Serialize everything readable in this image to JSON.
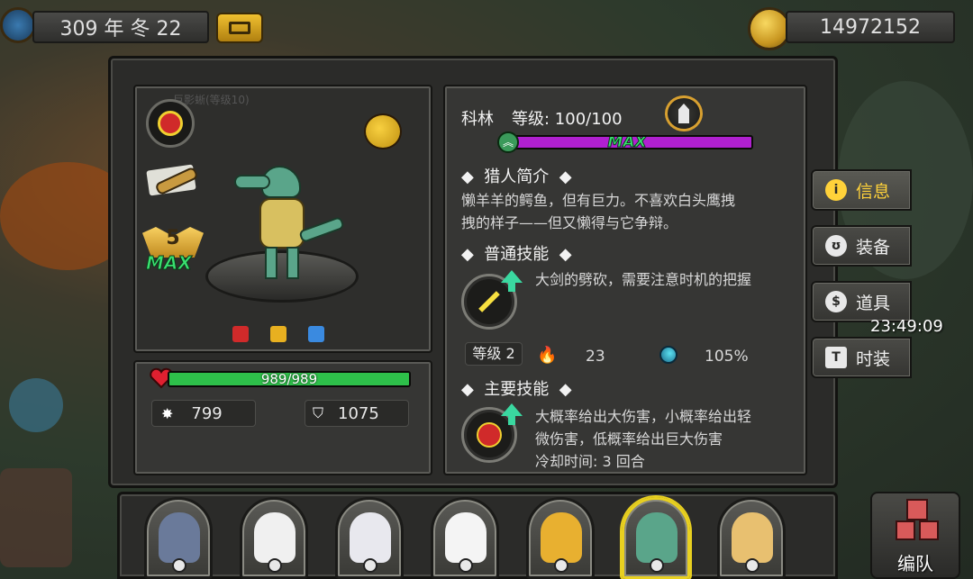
{
  "topbar": {
    "date": "309 年 冬 22",
    "coins": "14972152",
    "clock": "23:49:09"
  },
  "hero": {
    "name": "科林",
    "level_label": "等级: 100/100",
    "exp_progress": 1.0,
    "exp_badge": "MAX",
    "star_level": "5",
    "star_badge": "MAX",
    "faded_label": "巨影蜥(等级10)"
  },
  "stats": {
    "hp_text": "989/989",
    "hp_fraction": 1.0,
    "attack": "799",
    "defense": "1075"
  },
  "info": {
    "intro_title": "猎人简介",
    "intro_text_1": "懒羊羊的鳄鱼，但有巨力。不喜欢白头鹰拽",
    "intro_text_2": "拽的样子——但又懒得与它争辩。",
    "normal_skill_title": "普通技能",
    "normal_skill_text": "大剑的劈砍，需要注意时机的把握",
    "normal_skill_level": "等级 2",
    "normal_skill_power": "23",
    "normal_skill_crit": "105%",
    "main_skill_title": "主要技能",
    "main_skill_text_1": "大概率给出大伤害，小概率给出轻",
    "main_skill_text_2": "微伤害，低概率给出巨大伤害",
    "main_skill_cooldown": "冷却时间: 3 回合"
  },
  "tabs": [
    {
      "label": "信息",
      "icon": "info-icon",
      "active": true
    },
    {
      "label": "装备",
      "icon": "armor-icon",
      "active": false
    },
    {
      "label": "道具",
      "icon": "bag-icon",
      "active": false
    },
    {
      "label": "时装",
      "icon": "shirt-icon",
      "active": false
    }
  ],
  "roster": [
    {
      "name": "mole-hunter",
      "face": "#6a7a9a",
      "selected": false
    },
    {
      "name": "eagle-hunter",
      "face": "#f0f0f0",
      "selected": false
    },
    {
      "name": "sheep-hunter",
      "face": "#e8e8ee",
      "selected": false
    },
    {
      "name": "polar-bear-hunter",
      "face": "#f4f4f4",
      "selected": false
    },
    {
      "name": "leopard-hunter",
      "face": "#e8b030",
      "selected": false
    },
    {
      "name": "crocodile-hunter",
      "face": "#5aa58a",
      "selected": true
    },
    {
      "name": "giraffe-hunter",
      "face": "#e8c070",
      "selected": false
    }
  ],
  "team_button": "编队",
  "colors": {
    "hp_bar": "#2ec04a",
    "exp_bar": "#b020d0",
    "max_text": "#3ae070",
    "active_tab": "#ffd23a",
    "selected_border": "#e8d020"
  }
}
